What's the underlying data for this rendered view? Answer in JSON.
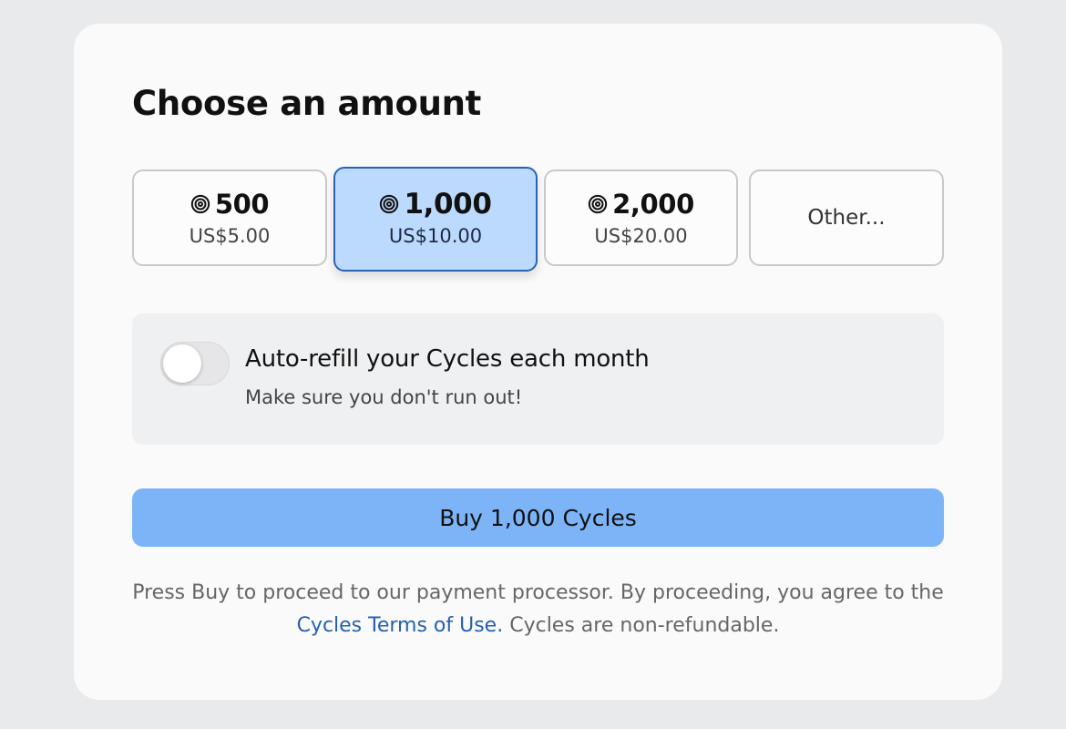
{
  "heading": "Choose an amount",
  "icon": "cycles-spiral-icon",
  "options": [
    {
      "amount": "500",
      "price": "US$5.00",
      "selected": false
    },
    {
      "amount": "1,000",
      "price": "US$10.00",
      "selected": true
    },
    {
      "amount": "2,000",
      "price": "US$20.00",
      "selected": false
    }
  ],
  "other_label": "Other...",
  "autorefill": {
    "title": "Auto-refill your Cycles each month",
    "subtitle": "Make sure you don't run out!",
    "enabled": false
  },
  "buy_label": "Buy 1,000 Cycles",
  "legal": {
    "text_before": "Press Buy to proceed to our payment processor. By proceeding, you agree to the",
    "link": "Cycles Terms of Use.",
    "text_after": "Cycles are non-refundable."
  },
  "colors": {
    "selected_fill": "#bcdafd",
    "selected_border": "#2a63b2",
    "buy_button": "#7db4f8",
    "link": "#2660b0"
  }
}
